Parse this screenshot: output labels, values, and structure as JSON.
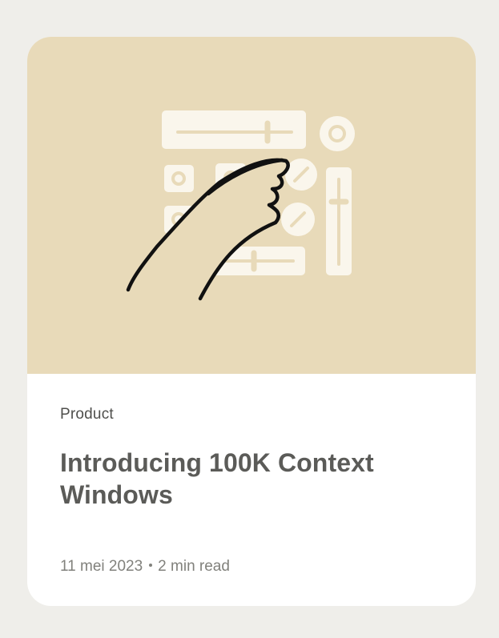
{
  "card": {
    "category": "Product",
    "title": "Introducing 100K Context Windows",
    "date": "11 mei 2023",
    "read_time": "2 min read",
    "illustration_icon": "hand-pointing-at-control-panel-icon"
  },
  "colors": {
    "page_background": "#efeeea",
    "illustration_background": "#e8dab9",
    "card_background": "#ffffff",
    "title_text": "#5b5b58",
    "meta_text": "#81817c"
  }
}
